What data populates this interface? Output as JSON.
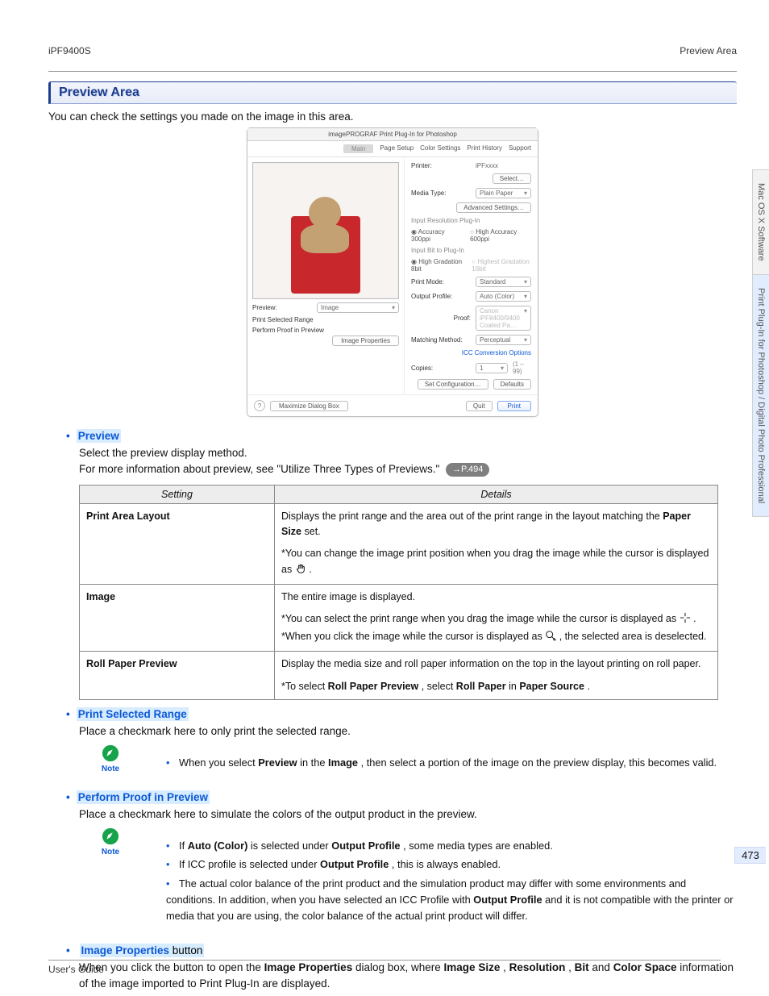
{
  "header": {
    "product": "iPF9400S",
    "section": "Preview Area"
  },
  "title": "Preview Area",
  "intro": "You can check the settings you made on the image in this area.",
  "screenshot": {
    "window_title": "imagePROGRAF Print Plug-In for Photoshop",
    "tabs": [
      "Main",
      "Page Setup",
      "Color Settings",
      "Print History",
      "Support"
    ],
    "left": {
      "preview_label": "Preview:",
      "preview_value": "Image",
      "link1": "Print Selected Range",
      "link2": "Perform Proof in Preview",
      "btn_img_prop": "Image Properties",
      "help_icon": "?",
      "btn_maximize": "Maximize Dialog Box"
    },
    "right": {
      "printer_lbl": "Printer:",
      "printer_val": "iPFxxxx",
      "select_btn": "Select…",
      "media_lbl": "Media Type:",
      "media_val": "Plain Paper",
      "adv_btn": "Advanced Settings…",
      "group1": "Input Resolution Plug-In",
      "res_a": "Accuracy 300ppi",
      "res_b": "High Accuracy 600ppi",
      "group2": "Input Bit to Plug-In",
      "bit_a": "High Gradation 8bit",
      "bit_b": "Highest Gradation 16bit",
      "mode_lbl": "Print Mode:",
      "mode_val": "Standard",
      "profile_lbl": "Output Profile:",
      "profile_val": "Auto (Color)",
      "proof_lbl": "Proof:",
      "proof_val": "Canon iPF8400/9400 Coated Pa…",
      "match_lbl": "Matching Method:",
      "match_val": "Perceptual",
      "icc_link": "ICC Conversion Options",
      "copies_lbl": "Copies:",
      "copies_val": "1",
      "copies_range": "(1 – 99)",
      "setcfg": "Set Configuration…",
      "defaults": "Defaults",
      "quit": "Quit",
      "print": "Print"
    }
  },
  "items": {
    "preview": {
      "title": "Preview",
      "body1": "Select the preview display method.",
      "body2a": "For more information about preview, see \"Utilize Three Types of Previews.\" ",
      "pref": "→P.494"
    },
    "print_selected": {
      "title": "Print Selected Range",
      "body": "Place a checkmark here to only print the selected range."
    },
    "proof": {
      "title": "Perform Proof in Preview",
      "body": "Place a checkmark here to simulate the colors of the output product in the preview."
    },
    "imgprop": {
      "title_strong": "Image Properties",
      "title_rest": " button",
      "body_a": "When you click the button to open the ",
      "b_ip": "Image Properties",
      "body_b": " dialog box, where ",
      "b_is": "Image Size",
      "c1": ", ",
      "b_res": "Resolution",
      "c2": ", ",
      "b_bit": "Bit",
      "body_c": " and ",
      "b_cs": "Color Space",
      "body_d": " information of the image imported to Print Plug-In are displayed."
    }
  },
  "table": {
    "h1": "Setting",
    "h2": "Details",
    "r1": {
      "k": "Print Area Layout",
      "d_a": "Displays the print range and the area out of the print range in the layout matching the ",
      "d_bold": "Paper Size",
      "d_b": " set.",
      "d_c": "*You can change the image print position when you drag the image while the cursor is displayed as ",
      "d_d": "."
    },
    "r2": {
      "k": "Image",
      "d_a": "The entire image is displayed.",
      "d_b": "*You can select the print range when you drag the image while the cursor is displayed as ",
      "d_c": ".",
      "d_d": "*When you click the image while the cursor is displayed as ",
      "d_e": ", the selected area is deselected."
    },
    "r3": {
      "k": "Roll Paper Preview",
      "d_a": "Display the media size and roll paper information on the top in the layout printing on roll paper.",
      "d_b": "*To select ",
      "b1": "Roll Paper Preview",
      "d_c": ", select ",
      "b2": "Roll Paper",
      "d_d": " in ",
      "b3": "Paper Source",
      "d_e": "."
    }
  },
  "note1": {
    "a": "When you select ",
    "b1": "Preview",
    "b": " in the ",
    "b2": "Image",
    "c": ", then select a portion of the image on the preview display, this becomes valid."
  },
  "note2": {
    "l1a": "If ",
    "l1b": "Auto (Color)",
    "l1c": " is selected under ",
    "l1d": "Output Profile",
    "l1e": ", some media types are enabled.",
    "l2a": "If ICC profile is selected under ",
    "l2b": "Output Profile",
    "l2c": ", this is always enabled.",
    "l3a": "The actual color balance of the print product and the simulation product may differ with some environments and conditions. In addition, when you have selected an ICC Profile with ",
    "l3b": "Output Profile",
    "l3c": " and it is not compatible with the printer or media that you are using, the color balance of the actual print product will differ."
  },
  "side": {
    "tab1": "Mac OS X Software",
    "tab2": "Print Plug-In for Photoshop / Digital Photo Professional"
  },
  "page_number": "473",
  "footer": "User's Guide"
}
